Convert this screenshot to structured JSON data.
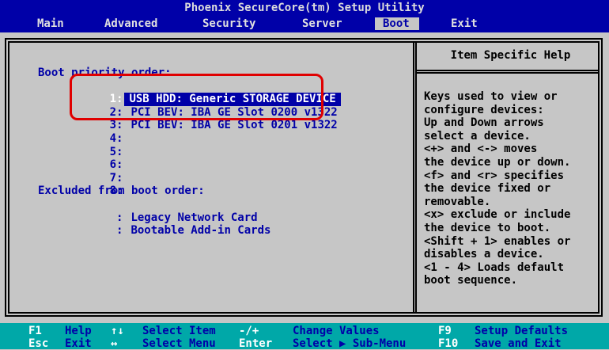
{
  "title": "Phoenix SecureCore(tm) Setup Utility",
  "menu": [
    {
      "label": "Main"
    },
    {
      "label": "Advanced"
    },
    {
      "label": "Security"
    },
    {
      "label": "Server"
    },
    {
      "label": "Boot"
    },
    {
      "label": "Exit"
    }
  ],
  "boot": {
    "priority_header": "Boot priority order:",
    "entries": [
      {
        "num": "1:",
        "device": "USB HDD: Generic STORAGE DEVICE"
      },
      {
        "num": "2:",
        "device": "PCI BEV: IBA GE Slot 0200 v1322"
      },
      {
        "num": "3:",
        "device": "PCI BEV: IBA GE Slot 0201 v1322"
      },
      {
        "num": "4:",
        "device": ""
      },
      {
        "num": "5:",
        "device": ""
      },
      {
        "num": "6:",
        "device": ""
      },
      {
        "num": "7:",
        "device": ""
      },
      {
        "num": "8:",
        "device": ""
      }
    ],
    "excluded_header": "Excluded from boot order:",
    "excluded": [
      {
        "num": ":",
        "device": "Legacy Network Card"
      },
      {
        "num": ":",
        "device": "Bootable Add-in Cards"
      }
    ]
  },
  "help": {
    "title": "Item Specific Help",
    "text": "Keys used to view or\nconfigure devices:\nUp and Down arrows\nselect a device.\n<+> and <-> moves\nthe device up or down.\n<f> and <r> specifies\nthe device fixed or\nremovable.\n<x> exclude or include\nthe device to boot.\n<Shift + 1> enables or\ndisables a device.\n<1 - 4> Loads default\nboot sequence."
  },
  "footer": {
    "f1": {
      "key": "F1",
      "desc": "Help"
    },
    "updown": {
      "key": "↑↓",
      "desc": "Select Item"
    },
    "minusplus": {
      "key": "-/+",
      "desc": "Change Values"
    },
    "f9": {
      "key": "F9",
      "desc": "Setup Defaults"
    },
    "esc": {
      "key": "Esc",
      "desc": "Exit"
    },
    "leftright": {
      "key": "↔",
      "desc": "Select Menu"
    },
    "enter": {
      "key": "Enter",
      "desc": "Select ▶ Sub-Menu"
    },
    "f10": {
      "key": "F10",
      "desc": "Save and Exit"
    }
  },
  "colors": {
    "bios_blue": "#0000a8",
    "background_gray": "#c6c6c6",
    "footer_cyan": "#00a8a8",
    "annotation_red": "#e00000"
  }
}
